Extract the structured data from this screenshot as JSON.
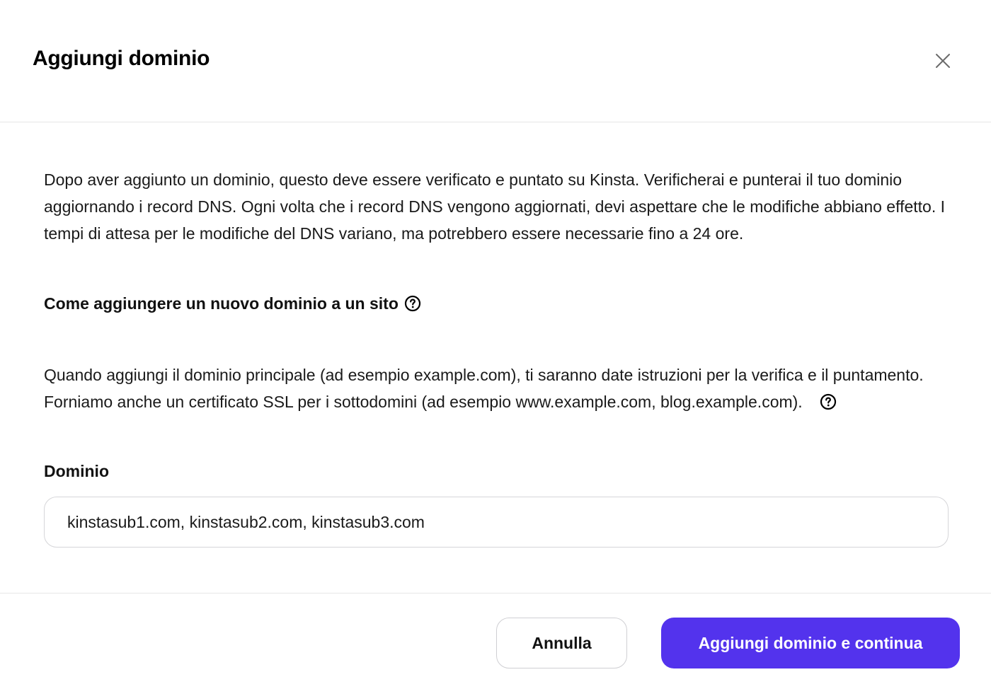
{
  "modal": {
    "title": "Aggiungi dominio",
    "close_icon": "close-icon"
  },
  "body": {
    "intro_text": "Dopo aver aggiunto un dominio, questo deve essere verificato e puntato su Kinsta. Verificherai e punterai il tuo dominio aggiornando i record DNS. Ogni volta che i record DNS vengono aggiornati, devi aspettare che le modifiche abbiano effetto. I tempi di attesa per le modifiche del DNS variano, ma potrebbero essere necessarie fino a 24 ore.",
    "howto_link": "Come aggiungere un nuovo dominio a un sito",
    "howto_icon": "question-circle-icon",
    "info_text": "Quando aggiungi il dominio principale (ad esempio example.com), ti saranno date istruzioni per la verifica e il puntamento. Forniamo anche un certificato SSL per i sottodomini (ad esempio www.example.com, blog.example.com).",
    "info_icon": "question-circle-icon"
  },
  "domain_field": {
    "label": "Dominio",
    "value": "kinstasub1.com, kinstasub2.com, kinstasub3.com"
  },
  "footer": {
    "cancel_label": "Annulla",
    "submit_label": "Aggiungi dominio e continua"
  },
  "colors": {
    "primary": "#5333ed",
    "border": "#d6d6d9",
    "divider": "#e6e6e6"
  }
}
